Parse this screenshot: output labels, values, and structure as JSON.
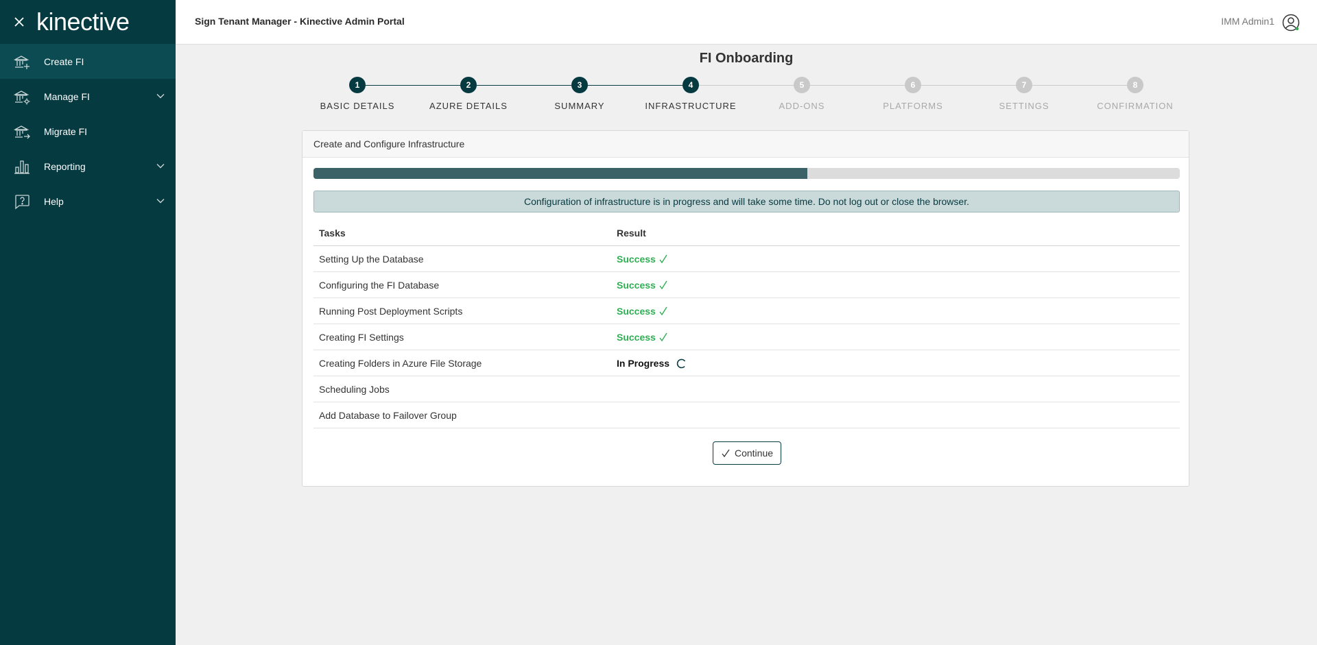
{
  "sidebar": {
    "logo": "kinective",
    "items": [
      {
        "label": "Create FI",
        "icon": "bank-plus-icon",
        "active": true
      },
      {
        "label": "Manage FI",
        "icon": "bank-gear-icon",
        "expandable": true
      },
      {
        "label": "Migrate FI",
        "icon": "bank-arrow-icon"
      },
      {
        "label": "Reporting",
        "icon": "bar-chart-icon",
        "expandable": true
      },
      {
        "label": "Help",
        "icon": "help-bubble-icon",
        "expandable": true
      }
    ]
  },
  "header": {
    "title": "Sign Tenant Manager - Kinective Admin Portal",
    "user": "IMM Admin1"
  },
  "page": {
    "title": "FI Onboarding"
  },
  "stepper": {
    "current_step": 4,
    "steps": [
      {
        "number": "1",
        "label": "BASIC DETAILS",
        "state": "complete"
      },
      {
        "number": "2",
        "label": "AZURE DETAILS",
        "state": "complete"
      },
      {
        "number": "3",
        "label": "SUMMARY",
        "state": "complete"
      },
      {
        "number": "4",
        "label": "INFRASTRUCTURE",
        "state": "current"
      },
      {
        "number": "5",
        "label": "ADD-ONS",
        "state": "pending"
      },
      {
        "number": "6",
        "label": "PLATFORMS",
        "state": "pending"
      },
      {
        "number": "7",
        "label": "SETTINGS",
        "state": "pending"
      },
      {
        "number": "8",
        "label": "CONFIRMATION",
        "state": "pending"
      }
    ]
  },
  "card": {
    "title": "Create and Configure Infrastructure",
    "progress_percent": 57,
    "alert": "Configuration of infrastructure is in progress and will take some time. Do not log out or close the browser.",
    "table": {
      "headers": [
        "Tasks",
        "Result"
      ],
      "rows": [
        {
          "task": "Setting Up the Database",
          "result": "Success",
          "status": "success"
        },
        {
          "task": "Configuring the FI Database",
          "result": "Success",
          "status": "success"
        },
        {
          "task": "Running Post Deployment Scripts",
          "result": "Success",
          "status": "success"
        },
        {
          "task": "Creating FI Settings",
          "result": "Success",
          "status": "success"
        },
        {
          "task": "Creating Folders in Azure File Storage",
          "result": "In Progress",
          "status": "in-progress"
        },
        {
          "task": "Scheduling Jobs",
          "result": "",
          "status": "none"
        },
        {
          "task": "Add Database to Failover Group",
          "result": "",
          "status": "none"
        }
      ]
    },
    "continue_label": "Continue"
  },
  "colors": {
    "sidebar_bg": "#063a41",
    "sidebar_active": "#0d4b52",
    "step_complete": "#063a41",
    "step_pending": "#c9c9c9",
    "progress_fill": "#3b6367",
    "success": "#2fae54"
  }
}
